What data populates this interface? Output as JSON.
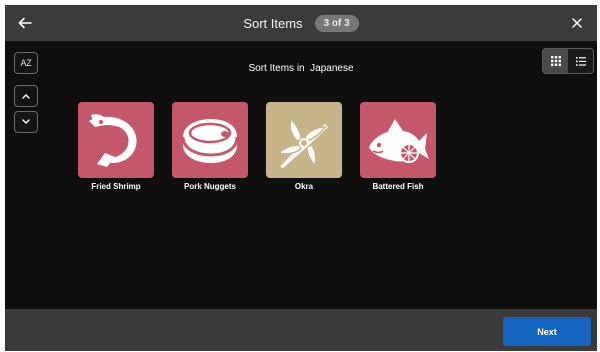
{
  "header": {
    "title": "Sort Items",
    "step_badge": "3 of 3",
    "back_icon": "arrow-left-icon",
    "close_icon": "close-icon"
  },
  "toolbar": {
    "sort_label": "AZ",
    "up_icon": "chevron-up-icon",
    "down_icon": "chevron-down-icon",
    "grid_icon": "grid-view-icon",
    "list_icon": "list-view-icon"
  },
  "main": {
    "heading": "Sort Items in  Japanese",
    "items": [
      {
        "label": "Fried Shrimp",
        "icon": "shrimp-icon",
        "color": "#c5576a"
      },
      {
        "label": "Pork Nuggets",
        "icon": "meat-steak-icon",
        "color": "#c5576a"
      },
      {
        "label": "Okra",
        "icon": "okra-icon",
        "color": "#c7b489"
      },
      {
        "label": "Battered Fish",
        "icon": "fish-icon",
        "color": "#c5576a"
      }
    ]
  },
  "footer": {
    "next_label": "Next"
  },
  "colors": {
    "accent": "#1565c0",
    "topbar": "#3b3b3b",
    "canvas": "#0f0f0f",
    "meat_tile": "#c5576a",
    "vegetable_tile": "#c7b489"
  }
}
